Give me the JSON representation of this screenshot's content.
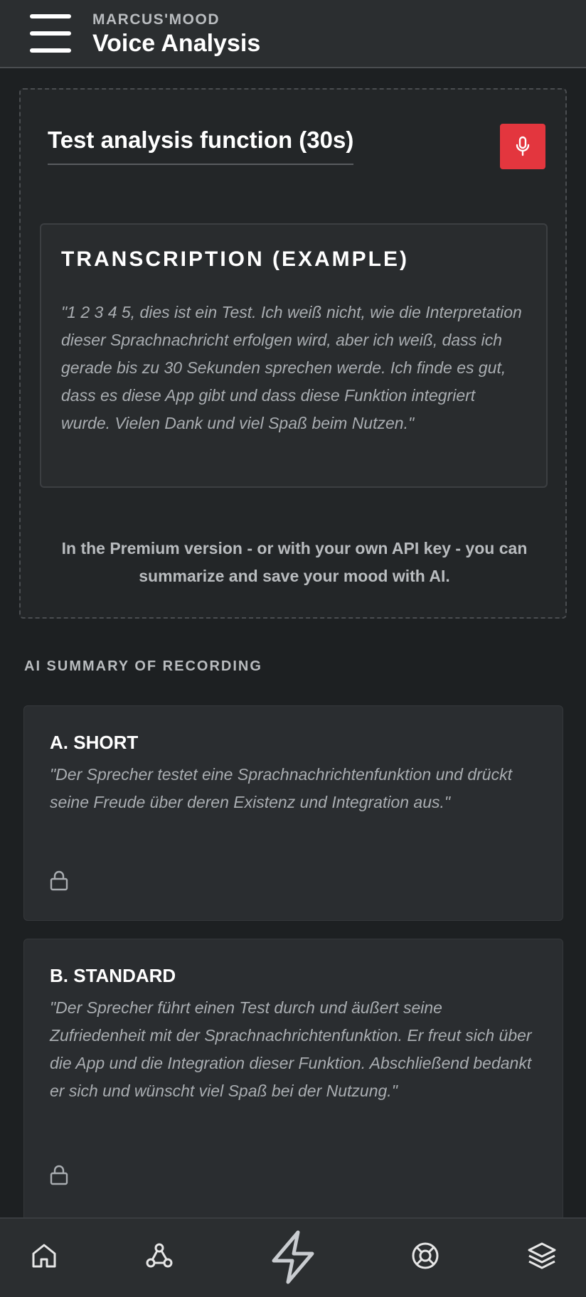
{
  "header": {
    "brand": "MARCUS'MOOD",
    "title": "Voice Analysis",
    "menu_icon": "hamburger-menu-icon"
  },
  "test": {
    "title": "Test analysis function (30s)",
    "mic_icon": "microphone-icon",
    "mic_color": "#e3363e",
    "transcription_heading": "TRANSCRIPTION (EXAMPLE)",
    "transcription_text": "\"1 2 3 4 5, dies ist ein Test. Ich weiß nicht, wie die Interpretation dieser Sprachnachricht erfolgen wird, aber ich weiß, dass ich gerade bis zu 30 Sekunden sprechen werde. Ich finde es gut, dass es diese App gibt und dass diese Funktion integriert wurde. Vielen Dank und viel Spaß beim Nutzen.\"",
    "premium_note": "In the Premium version - or with your own API key - you can summarize and save your mood with AI."
  },
  "summary": {
    "section_label": "AI SUMMARY OF RECORDING",
    "cards": [
      {
        "title": "A. SHORT",
        "text": "\"Der Sprecher testet eine Sprachnachrichtenfunktion und drückt seine Freude über deren Existenz und Integration aus.\"",
        "icon": "lock-icon"
      },
      {
        "title": "B. STANDARD",
        "text": "\"Der Sprecher führt einen Test durch und äußert seine Zufriedenheit mit der Sprachnachrichtenfunktion. Er freut sich über die App und die Integration dieser Funktion. Abschließend bedankt er sich und wünscht viel Spaß bei der Nutzung.\"",
        "icon": "lock-icon"
      }
    ]
  },
  "bottom_nav": {
    "items": [
      "home-icon",
      "webhook-icon",
      "lightning-icon",
      "lifebuoy-icon",
      "layers-icon"
    ]
  }
}
